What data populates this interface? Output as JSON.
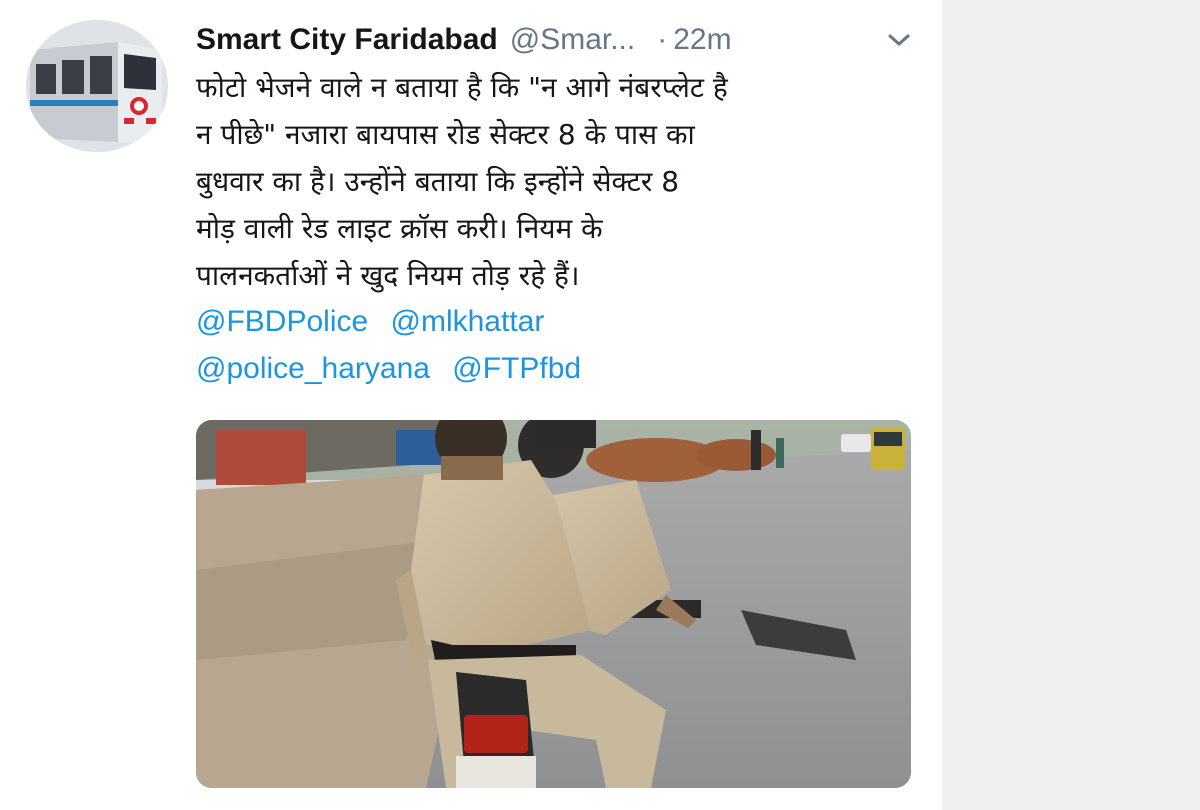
{
  "author": {
    "display_name": "Smart City Faridabad",
    "handle": "@Smar...",
    "separator": "·",
    "time": "22m"
  },
  "tweet": {
    "lines": [
      "फोटो भेजने वाले न बताया है कि \"न आगे नंबरप्लेट है",
      "न पीछे\" नजारा बायपास रोड सेक्टर 8 के पास का",
      "बुधवार का है। उन्होंने बताया कि  इन्होंने सेक्टर 8",
      "मोड़ वाली रेड लाइट क्रॉस करी। नियम के",
      "पालनकर्ताओं ने  खुद नियम तोड़ रहे हैं।"
    ],
    "mentions": [
      "@FBDPolice",
      "@mlkhattar",
      "@police_haryana",
      "@FTPfbd"
    ]
  },
  "icons": {
    "caret": "chevron-down-icon",
    "avatar": "metro-train-avatar"
  },
  "colors": {
    "text": "#14171a",
    "secondary": "#657786",
    "link": "#1b95e0",
    "side_panel": "#eff0f2"
  }
}
